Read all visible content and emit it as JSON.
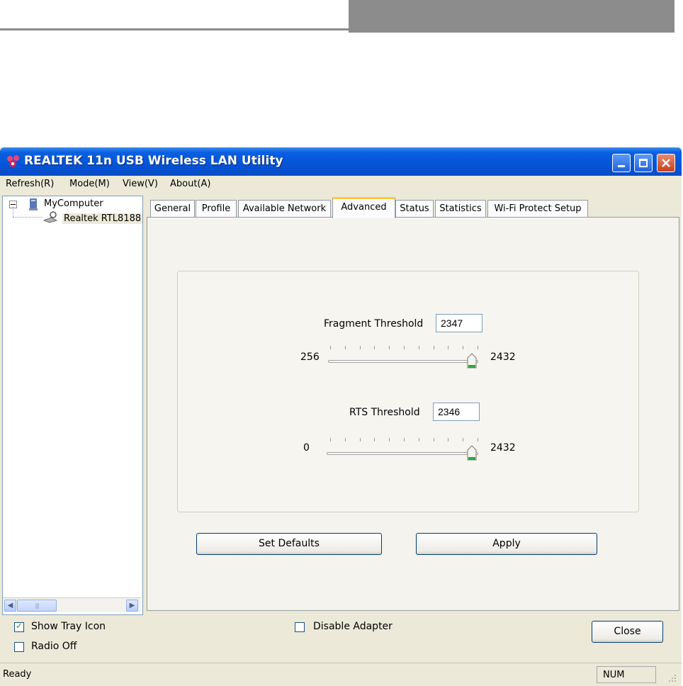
{
  "window": {
    "title": "REALTEK 11n USB Wireless LAN Utility",
    "titlebar_color": "#0454d8"
  },
  "menu": [
    "Refresh(R)",
    "Mode(M)",
    "View(V)",
    "About(A)"
  ],
  "tree": {
    "root": "MyComputer",
    "child": "Realtek RTL8188"
  },
  "tabs": [
    {
      "label": "General"
    },
    {
      "label": "Profile"
    },
    {
      "label": "Available Network"
    },
    {
      "label": "Advanced",
      "active": true
    },
    {
      "label": "Status"
    },
    {
      "label": "Statistics"
    },
    {
      "label": "Wi-Fi Protect Setup"
    }
  ],
  "advanced": {
    "fragment": {
      "label": "Fragment Threshold",
      "value": "2347",
      "min": "256",
      "max": "2432",
      "level": 0.96
    },
    "rts": {
      "label": "RTS Threshold",
      "value": "2346",
      "min": "0",
      "max": "2432",
      "level": 0.96
    },
    "set_defaults": "Set Defaults",
    "apply": "Apply"
  },
  "options": {
    "show_tray_icon": {
      "label": "Show Tray Icon",
      "checked": true
    },
    "radio_off": {
      "label": "Radio Off",
      "checked": false
    },
    "disable_adapter": {
      "label": "Disable Adapter",
      "checked": false
    },
    "close": "Close"
  },
  "status": {
    "text": "Ready",
    "num": "NUM"
  },
  "icons": [
    "app-icon",
    "minimize-icon",
    "maximize-icon",
    "close-icon",
    "computer-icon",
    "network-adapter-icon",
    "scroll-left-icon",
    "scroll-right-icon",
    "check-icon",
    "resize-grip-icon"
  ]
}
